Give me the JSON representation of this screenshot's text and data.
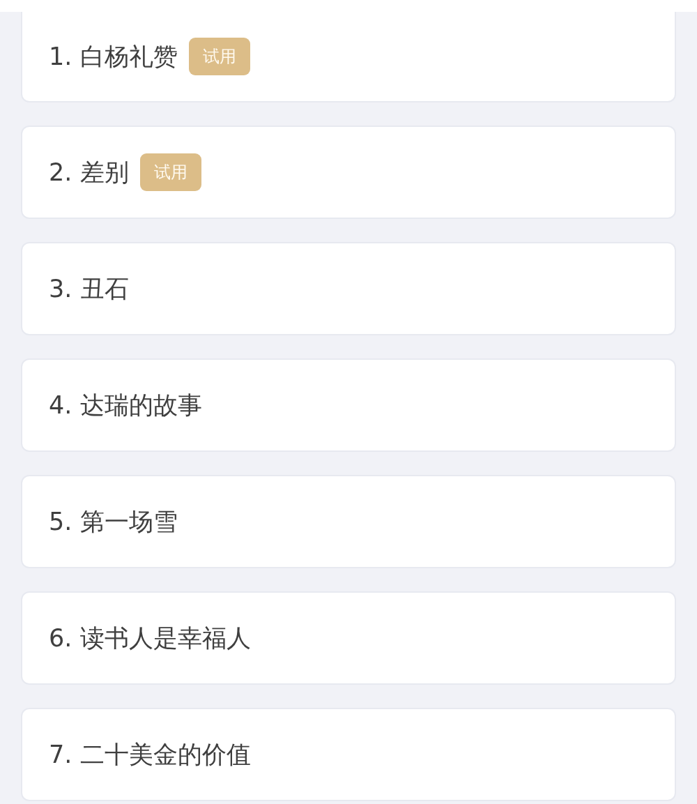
{
  "lessons": [
    {
      "title": "1. 白杨礼赞",
      "badge": "试用"
    },
    {
      "title": "2. 差别",
      "badge": "试用"
    },
    {
      "title": "3. 丑石"
    },
    {
      "title": "4. 达瑞的故事"
    },
    {
      "title": "5. 第一场雪"
    },
    {
      "title": "6. 读书人是幸福人"
    },
    {
      "title": "7. 二十美金的价值"
    }
  ]
}
